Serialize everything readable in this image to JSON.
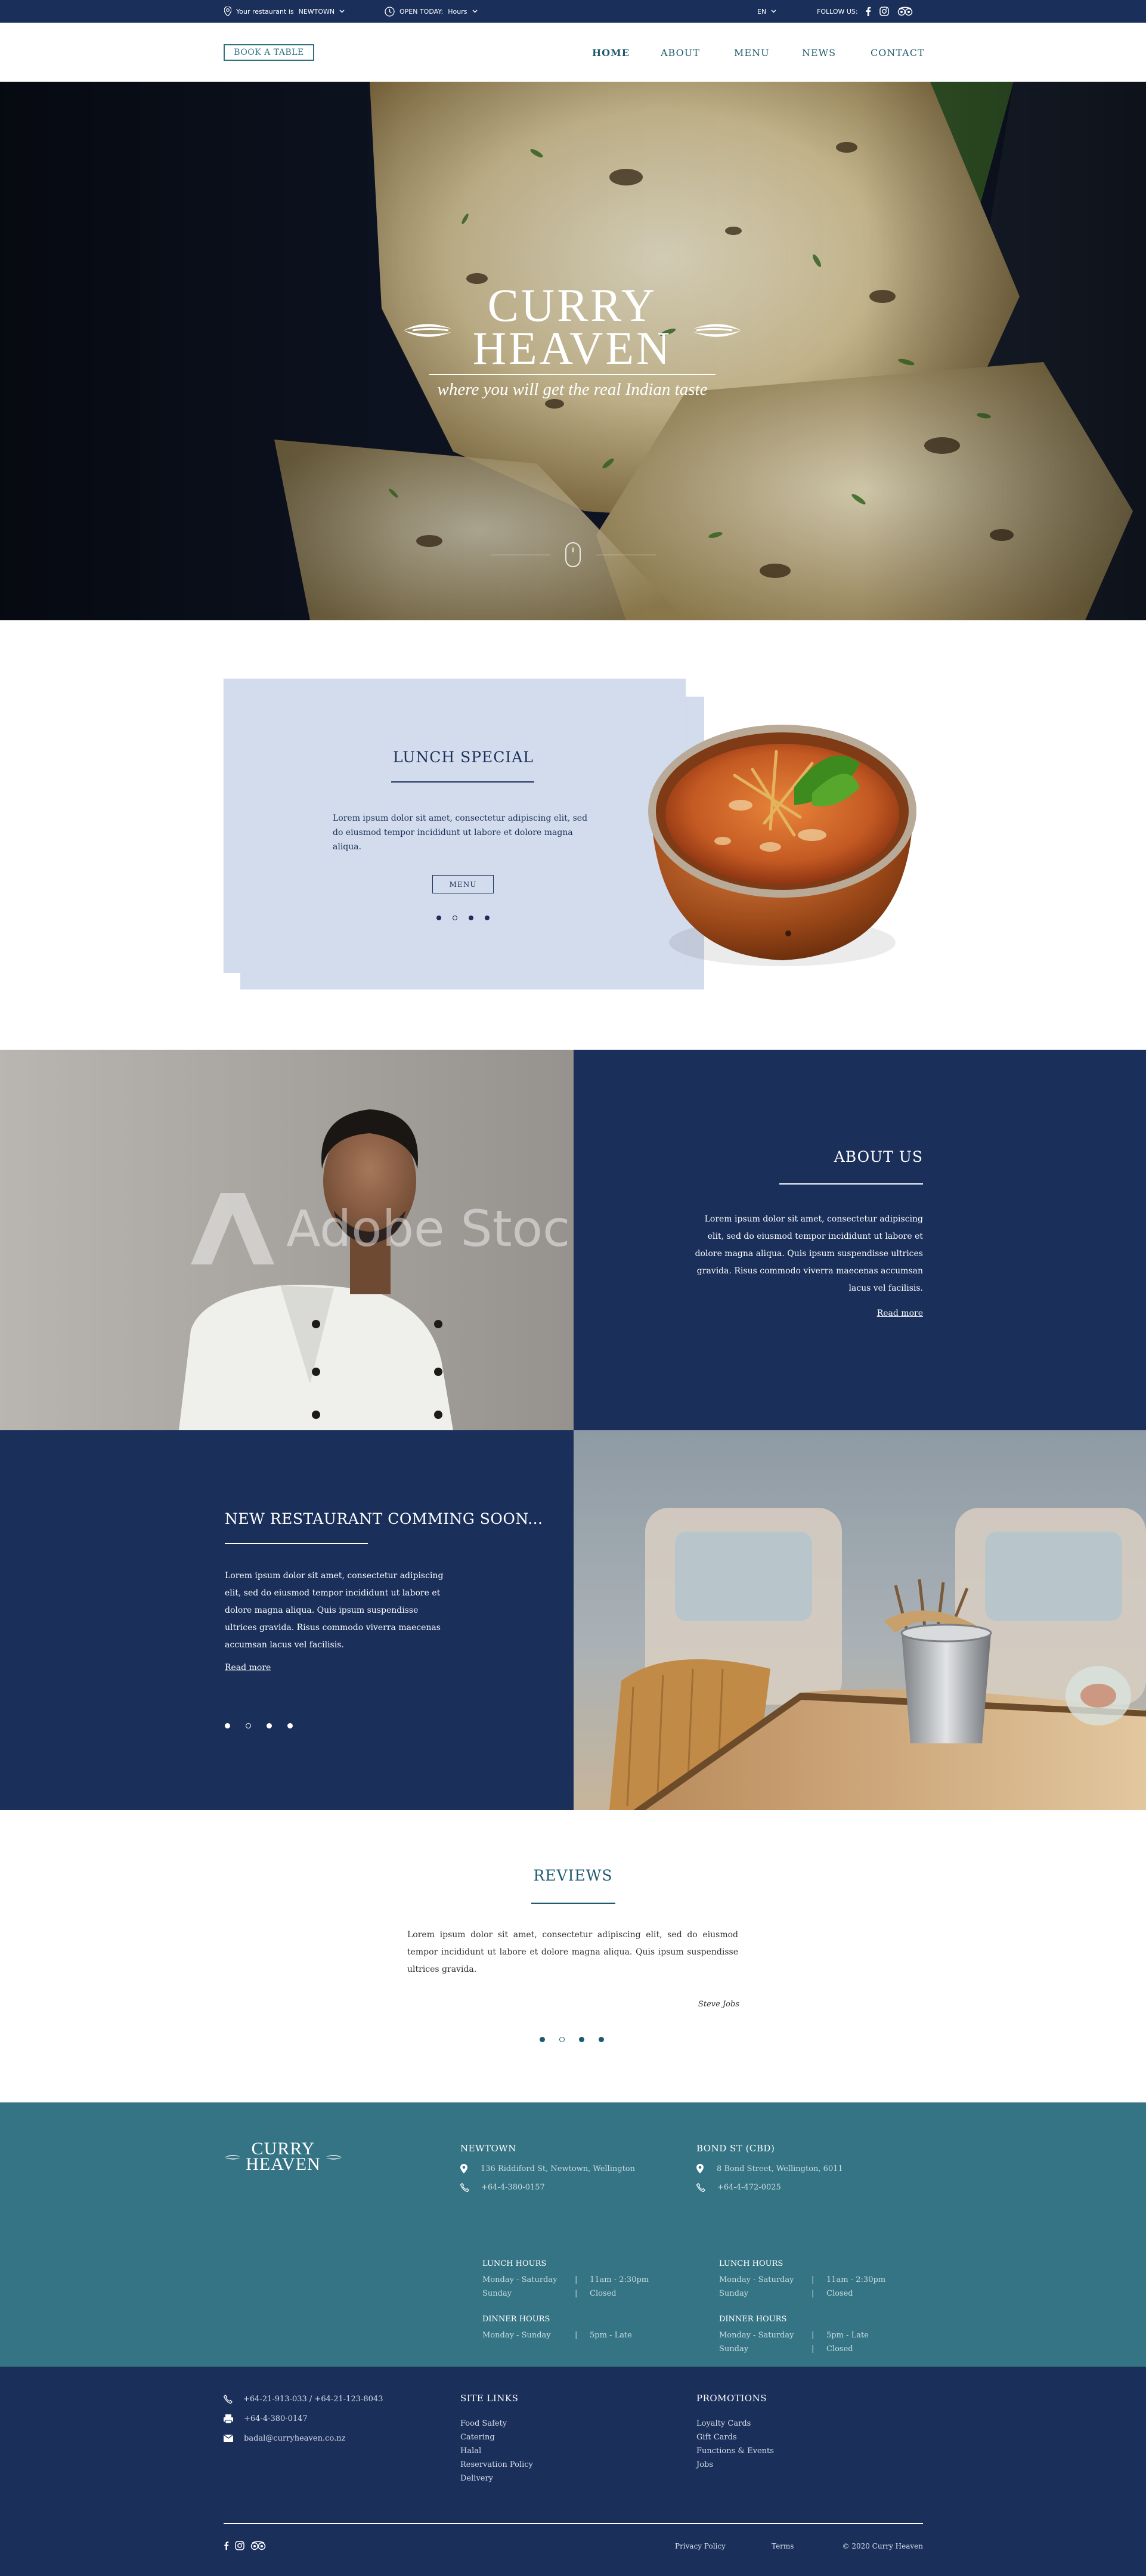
{
  "topbar": {
    "location_prefix": "Your restaurant is",
    "location_value": "NEWTOWN",
    "open_prefix": "OPEN TODAY:",
    "open_value": "Hours",
    "language": "EN",
    "follow_label": "FOLLOW US:"
  },
  "nav": {
    "book_label": "BOOK A TABLE",
    "links": [
      "HOME",
      "ABOUT",
      "MENU",
      "NEWS",
      "CONTACT"
    ]
  },
  "hero": {
    "logo_line1": "CURRY",
    "logo_line2": "HEAVEN",
    "tagline": "where you will get the real Indian taste"
  },
  "lunch": {
    "title": "LUNCH SPECIAL",
    "body": "Lorem ipsum dolor sit amet, consectetur adipiscing elit, sed do eiusmod tempor incididunt ut labore et dolore magna aliqua.",
    "button": "MENU"
  },
  "about": {
    "title": "ABOUT US",
    "body": "Lorem ipsum dolor sit amet, consectetur adipiscing elit, sed do eiusmod tempor incididunt ut labore et dolore magna aliqua. Quis ipsum suspendisse ultrices gravida. Risus commodo viverra maecenas accumsan lacus vel facilisis.",
    "read_more": "Read more",
    "watermark": "Adobe Stock"
  },
  "new_restaurant": {
    "title": "NEW RESTAURANT COMMING SOON...",
    "body": "Lorem ipsum dolor sit amet, consectetur adipiscing elit, sed do eiusmod tempor incididunt ut labore et dolore magna aliqua. Quis ipsum suspendisse ultrices gravida. Risus commodo viverra maecenas accumsan lacus vel facilisis.",
    "read_more": "Read more"
  },
  "reviews": {
    "title": "REVIEWS",
    "body": "Lorem ipsum dolor sit amet, consectetur adipiscing elit, sed do eiusmod tempor incididunt ut labore et dolore magna aliqua. Quis ipsum suspendisse ultrices gravida.",
    "author": "Steve Jobs"
  },
  "footer": {
    "logo_line1": "CURRY",
    "logo_line2": "HEAVEN",
    "newtown": {
      "title": "NEWTOWN",
      "address": "136 Riddiford St, Newtown, Wellington",
      "phone": "+64-4-380-0157",
      "lunch_title": "LUNCH HOURS",
      "lunch_rows": [
        [
          "Monday - Saturday",
          "11am - 2:30pm"
        ],
        [
          "Sunday",
          "Closed"
        ]
      ],
      "dinner_title": "DINNER HOURS",
      "dinner_rows": [
        [
          "Monday - Sunday",
          "5pm - Late"
        ]
      ]
    },
    "bond": {
      "title": "BOND ST (CBD)",
      "address": "8 Bond Street, Wellington, 6011",
      "phone": "+64-4-472-0025",
      "lunch_title": "LUNCH HOURS",
      "lunch_rows": [
        [
          "Monday - Saturday",
          "11am - 2:30pm"
        ],
        [
          "Sunday",
          "Closed"
        ]
      ],
      "dinner_title": "DINNER HOURS",
      "dinner_rows": [
        [
          "Monday - Saturday",
          "5pm - Late"
        ],
        [
          "Sunday",
          "Closed"
        ]
      ]
    },
    "contact": {
      "phones": "+64-21-913-033 / +64-21-123-8043",
      "fax": "+64-4-380-0147",
      "email": "badal@curryheaven.co.nz"
    },
    "site_links": {
      "title": "SITE LINKS",
      "items": [
        "Food Safety",
        "Catering",
        "Halal",
        "Reservation Policy",
        "Delivery"
      ]
    },
    "promotions": {
      "title": "PROMOTIONS",
      "items": [
        "Loyalty Cards",
        "Gift Cards",
        "Functions & Events",
        "Jobs"
      ]
    },
    "bottom": {
      "privacy": "Privacy Policy",
      "terms": "Terms",
      "copyright": "© 2020 Curry Heaven"
    }
  },
  "colors": {
    "navy": "#1a2f5a",
    "teal": "#357484",
    "light_blue": "#d3dcec"
  }
}
